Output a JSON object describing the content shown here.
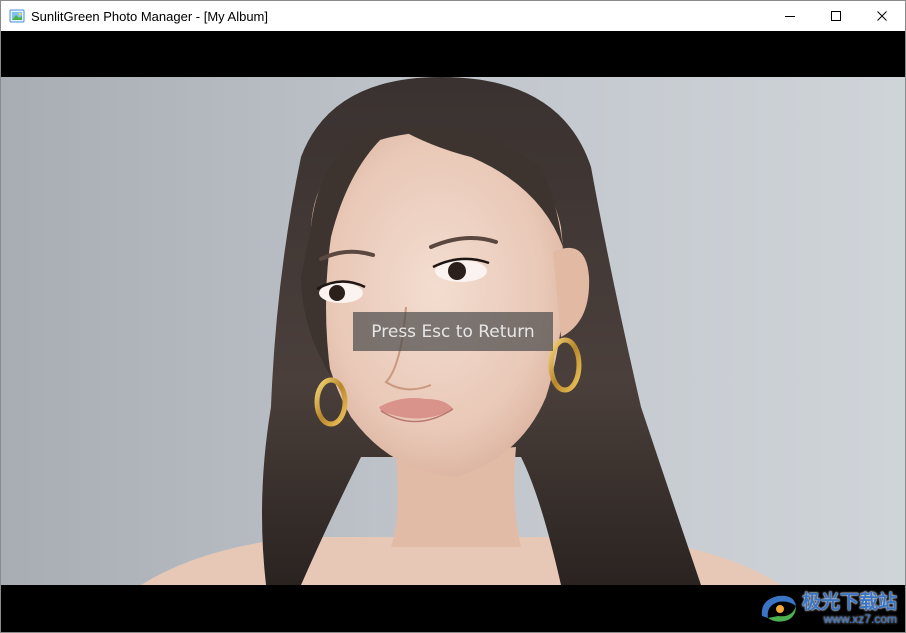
{
  "window": {
    "title": "SunlitGreen Photo Manager - [My Album]",
    "app_icon": "photo-app-icon",
    "controls": [
      "minimize-icon",
      "maximize-icon",
      "close-icon"
    ]
  },
  "viewer": {
    "background_color": "#000000",
    "photo_description_icon": "portrait-photo",
    "hint": "Press Esc to Return"
  },
  "watermark": {
    "logo": "xz7-logo-icon",
    "name": "极光下载站",
    "url": "www.xz7.com"
  }
}
